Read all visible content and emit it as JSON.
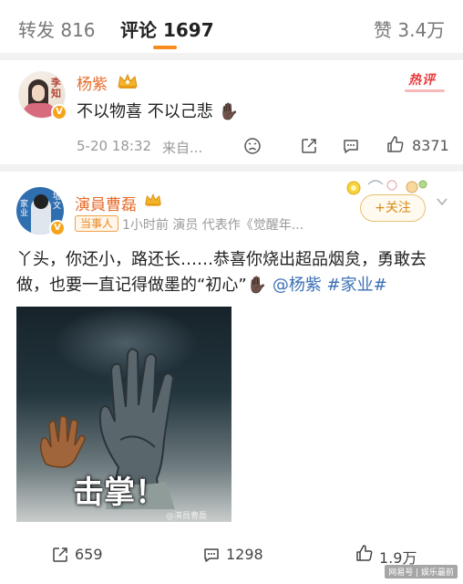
{
  "tabs": {
    "repost": "转发 816",
    "comments": "评论 1697",
    "likes": "赞 3.4万"
  },
  "comment": {
    "avatar_seal": "李\n知",
    "username": "杨紫",
    "hot_label": "热评",
    "text": "不以物喜 不以己悲",
    "hand_emoji": "✋🏿",
    "time": "5-20 18:32",
    "source": "来自...",
    "like_count": "8371"
  },
  "post": {
    "username": "演員曹磊",
    "badge": "当事人",
    "meta": "1小时前  演员 代表作《觉醒年...",
    "follow_label": "+关注",
    "line1": "丫头，你还小，路还长……恭喜你烧出超品烟炱，勇敢去",
    "line2_prefix": "做，也要一直记得做墨的“初心”",
    "line2_hand": "✋🏿",
    "mention": "@杨紫",
    "hashtag": "#家业#",
    "image_caption": "击掌！",
    "image_watermark": "@演員曹磊",
    "repost_count": "659",
    "comment_count": "1298",
    "like_count": "1.9万"
  },
  "watermark": "网易号 | 娱乐最前"
}
